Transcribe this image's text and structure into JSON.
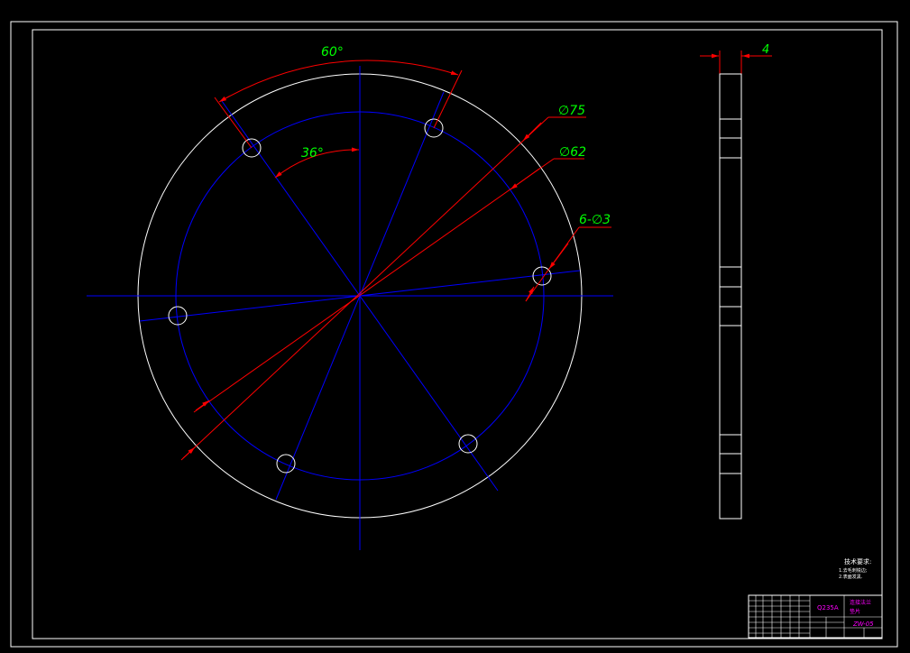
{
  "dimensions": {
    "angle_60": "60°",
    "angle_36": "36°",
    "dia_75": "∅75",
    "dia_62": "∅62",
    "holes": "6-∅3",
    "thickness": "4"
  },
  "notes": {
    "title": "技术要求:",
    "line1": "1.去毛刺锐边;",
    "line2": "2.表面发黑."
  },
  "title_block": {
    "material": "Q235A",
    "drawing_title": "连接法兰",
    "part_name": "垫片",
    "drawing_no": "ZW-05"
  },
  "colors": {
    "outline": "#ffffff",
    "centerline": "#0000ff",
    "dimension": "#ff0000",
    "dim_text": "#00ff00",
    "title_text": "#ff00ff",
    "background": "#000000"
  }
}
